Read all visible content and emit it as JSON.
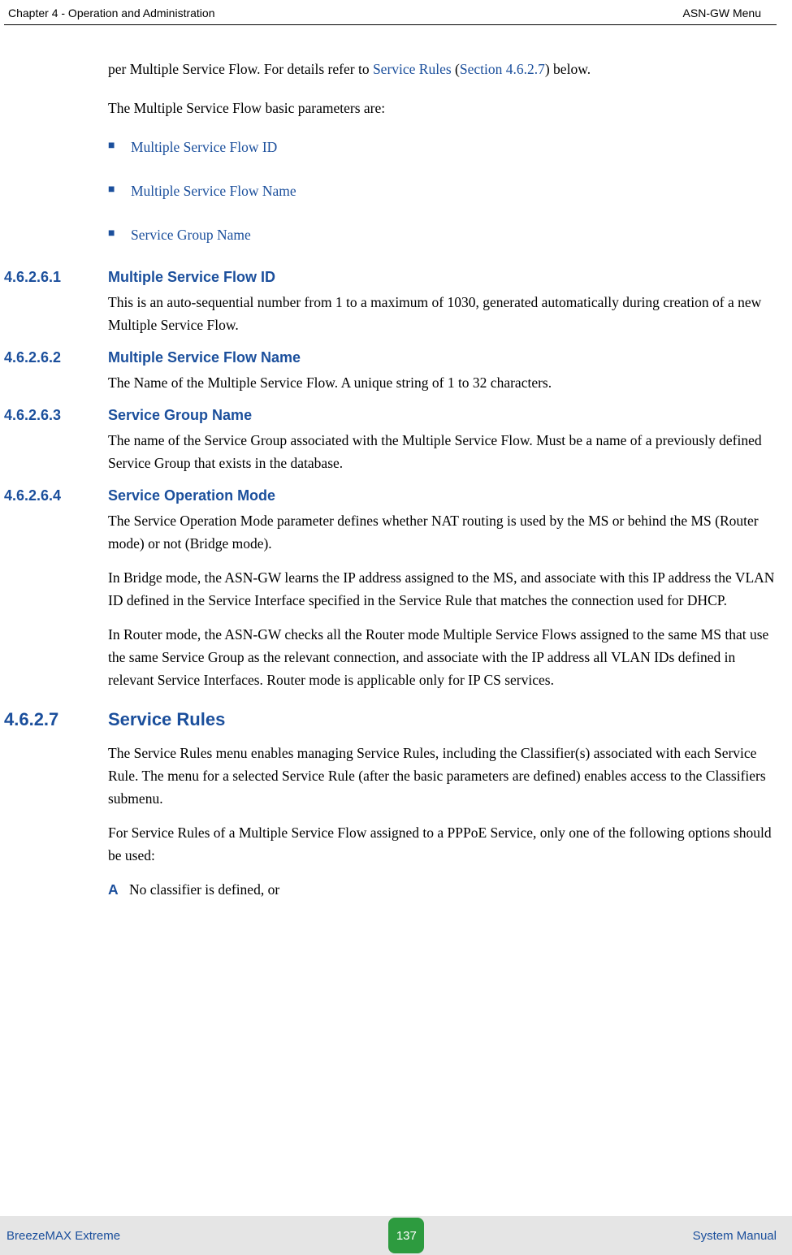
{
  "header": {
    "left": "Chapter 4 - Operation and Administration",
    "right": "ASN-GW Menu"
  },
  "intro": {
    "para1_prefix": "per Multiple Service Flow. For details refer to ",
    "para1_link1": "Service Rules",
    "para1_mid": " (",
    "para1_link2": "Section 4.6.2.7",
    "para1_suffix": ") below.",
    "para2": "The Multiple Service Flow basic parameters are:"
  },
  "bullets": {
    "b1": "Multiple Service Flow ID",
    "b2": "Multiple Service Flow Name",
    "b3": "Service Group Name"
  },
  "sections": {
    "s1": {
      "num": "4.6.2.6.1",
      "title": "Multiple Service Flow ID",
      "body": "This is an auto-sequential number from 1 to a maximum of 1030, generated automatically during creation of a new Multiple Service Flow."
    },
    "s2": {
      "num": "4.6.2.6.2",
      "title": "Multiple Service Flow Name",
      "body": "The Name of the Multiple Service Flow. A unique string of 1 to 32 characters."
    },
    "s3": {
      "num": "4.6.2.6.3",
      "title": "Service Group Name",
      "body": "The name of the Service Group associated with the Multiple Service Flow. Must be a name of a previously defined Service Group that exists in the database."
    },
    "s4": {
      "num": "4.6.2.6.4",
      "title": "Service Operation Mode",
      "p1": "The Service Operation Mode parameter defines whether NAT routing is used by the MS or behind the MS (Router mode) or not (Bridge mode).",
      "p2": "In Bridge mode, the ASN-GW learns the IP address assigned to the MS, and associate with this IP address the VLAN ID defined in the Service Interface specified in the Service Rule that matches the connection used for DHCP.",
      "p3": "In Router mode, the ASN-GW checks all the Router mode Multiple Service Flows assigned to the same MS that use the same Service Group as the relevant connection, and associate with the IP address all VLAN IDs defined in relevant Service Interfaces. Router mode is applicable only for IP CS services."
    },
    "s5": {
      "num": "4.6.2.7",
      "title": "Service Rules",
      "p1": "The Service Rules menu enables managing Service Rules, including the Classifier(s) associated with each Service Rule. The menu for a selected Service Rule (after the basic parameters are defined) enables access to the Classifiers submenu.",
      "p2": "For Service Rules of a Multiple Service Flow assigned to a PPPoE Service, only one of the following options should be used:",
      "item_a_letter": "A",
      "item_a_text": "No classifier is defined, or"
    }
  },
  "footer": {
    "left": "BreezeMAX Extreme",
    "page": "137",
    "right": "System Manual"
  }
}
